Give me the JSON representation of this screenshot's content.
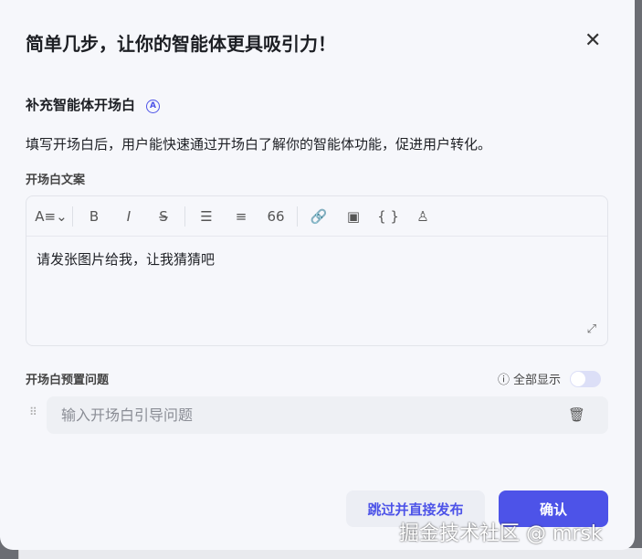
{
  "dialog": {
    "title": "简单几步，让你的智能体更具吸引力！",
    "section_title": "补充智能体开场白",
    "ai_badge": "A",
    "description": "填写开场白后，用户能快速通过开场白了解你的智能体功能，促进用户转化。"
  },
  "editor": {
    "label": "开场白文案",
    "content": "请发张图片给我，让我猜猜吧",
    "toolbar": [
      "A≡⌄",
      "B",
      "I",
      "S̶",
      "☰",
      "≡",
      "66",
      "🔗",
      "▣",
      "{ }",
      "♙"
    ]
  },
  "questions": {
    "label": "开场白预置问题",
    "show_all_label": "全部显示",
    "show_all_on": false,
    "placeholder": "输入开场白引导问题"
  },
  "buttons": {
    "skip": "跳过并直接发布",
    "confirm": "确认"
  },
  "watermark": "掘金技术社区 @ mrsk"
}
